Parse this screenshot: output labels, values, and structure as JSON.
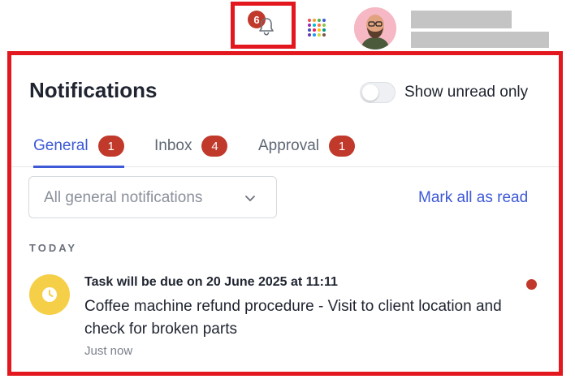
{
  "header": {
    "notifications_badge": "6",
    "bell_icon": "bell-icon",
    "apps_icon": "apps-grid-icon",
    "app_dot_colors": [
      "#e8505b",
      "#f0a030",
      "#4caf50",
      "#3d59d6",
      "#9c27b0",
      "#00bcd4",
      "#ff7043",
      "#8bc34a",
      "#3f51b5",
      "#e91e63",
      "#ffc107",
      "#009688",
      "#673ab7",
      "#2196f3",
      "#cddc39",
      "#795548"
    ]
  },
  "panel": {
    "title": "Notifications",
    "toggle_label": "Show unread only",
    "toggle_on": false,
    "tabs": [
      {
        "label": "General",
        "count": "1",
        "active": true
      },
      {
        "label": "Inbox",
        "count": "4",
        "active": false
      },
      {
        "label": "Approval",
        "count": "1",
        "active": false
      }
    ],
    "filter": {
      "selected": "All general notifications"
    },
    "mark_all_read": "Mark all as read",
    "section_label": "TODAY",
    "notifications": [
      {
        "title": "Task will be due on 20 June 2025 at 11:11",
        "body": "Coffee machine refund procedure - Visit to client location and check for broken parts",
        "time": "Just now",
        "icon": "clock-icon",
        "unread": true
      }
    ]
  },
  "colors": {
    "accent": "#3d59d6",
    "badge": "#c0392b",
    "highlight_border": "#e3171e",
    "clock_bg": "#f5cf47"
  }
}
